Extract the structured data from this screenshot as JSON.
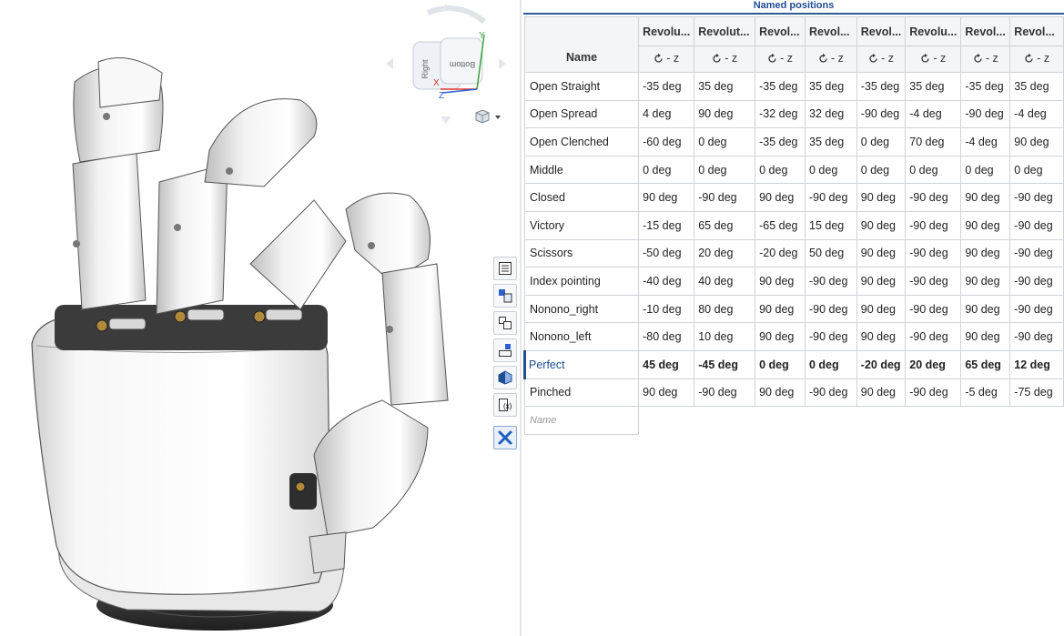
{
  "viewcube": {
    "faces": [
      "Right",
      "Bottom"
    ],
    "axes": [
      "X",
      "Y",
      "Z"
    ],
    "colors": {
      "x": "#e0332b",
      "y": "#3aa540",
      "z": "#2c5fd1"
    }
  },
  "toolbar": {
    "items": [
      {
        "name": "features-list-icon"
      },
      {
        "name": "parts-list-icon"
      },
      {
        "name": "instances-icon"
      },
      {
        "name": "mate-features-icon"
      },
      {
        "name": "appearance-icon"
      },
      {
        "name": "variables-icon"
      },
      {
        "name": "named-positions-icon"
      }
    ]
  },
  "panel": {
    "title": "Named positions",
    "name_header": "Name",
    "columns": [
      {
        "label": "Revolu...",
        "axis": "- z"
      },
      {
        "label": "Revolut...",
        "axis": "- z"
      },
      {
        "label": "Revol...",
        "axis": "- z"
      },
      {
        "label": "Revol...",
        "axis": "- z"
      },
      {
        "label": "Revol...",
        "axis": "- z"
      },
      {
        "label": "Revolu...",
        "axis": "- z"
      },
      {
        "label": "Revol...",
        "axis": "- z"
      },
      {
        "label": "Revol...",
        "axis": "- z"
      }
    ],
    "rows": [
      {
        "name": "Open Straight",
        "values": [
          "-35 deg",
          "35 deg",
          "-35 deg",
          "35 deg",
          "-35 deg",
          "35 deg",
          "-35 deg",
          "35 deg"
        ]
      },
      {
        "name": "Open Spread",
        "values": [
          "4 deg",
          "90 deg",
          "-32 deg",
          "32 deg",
          "-90 deg",
          "-4 deg",
          "-90 deg",
          "-4 deg"
        ]
      },
      {
        "name": "Open Clenched",
        "values": [
          "-60 deg",
          "0 deg",
          "-35 deg",
          "35 deg",
          "0 deg",
          "70 deg",
          "-4 deg",
          "90 deg"
        ]
      },
      {
        "name": "Middle",
        "values": [
          "0 deg",
          "0 deg",
          "0 deg",
          "0 deg",
          "0 deg",
          "0 deg",
          "0 deg",
          "0 deg"
        ]
      },
      {
        "name": "Closed",
        "values": [
          "90 deg",
          "-90 deg",
          "90 deg",
          "-90 deg",
          "90 deg",
          "-90 deg",
          "90 deg",
          "-90 deg"
        ]
      },
      {
        "name": "Victory",
        "values": [
          "-15 deg",
          "65 deg",
          "-65 deg",
          "15 deg",
          "90 deg",
          "-90 deg",
          "90 deg",
          "-90 deg"
        ]
      },
      {
        "name": "Scissors",
        "values": [
          "-50 deg",
          "20 deg",
          "-20 deg",
          "50 deg",
          "90 deg",
          "-90 deg",
          "90 deg",
          "-90 deg"
        ]
      },
      {
        "name": "Index pointing",
        "values": [
          "-40 deg",
          "40 deg",
          "90 deg",
          "-90 deg",
          "90 deg",
          "-90 deg",
          "90 deg",
          "-90 deg"
        ]
      },
      {
        "name": "Nonono_right",
        "values": [
          "-10 deg",
          "80 deg",
          "90 deg",
          "-90 deg",
          "90 deg",
          "-90 deg",
          "90 deg",
          "-90 deg"
        ]
      },
      {
        "name": "Nonono_left",
        "values": [
          "-80 deg",
          "10 deg",
          "90 deg",
          "-90 deg",
          "90 deg",
          "-90 deg",
          "90 deg",
          "-90 deg"
        ]
      },
      {
        "name": "Perfect",
        "values": [
          "45 deg",
          "-45 deg",
          "0 deg",
          "0 deg",
          "-20 deg",
          "20 deg",
          "65 deg",
          "12 deg"
        ],
        "selected": true
      },
      {
        "name": "Pinched",
        "values": [
          "90 deg",
          "-90 deg",
          "90 deg",
          "-90 deg",
          "90 deg",
          "-90 deg",
          "-5 deg",
          "-75 deg"
        ]
      }
    ],
    "new_row_placeholder": "Name",
    "accent_color": "#1f4e93"
  }
}
